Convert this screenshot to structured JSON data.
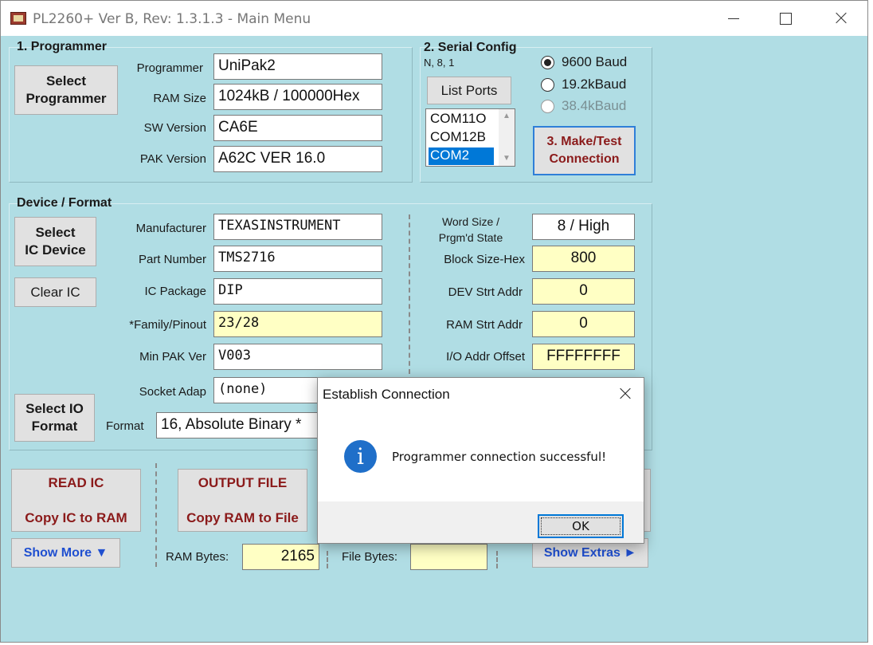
{
  "window": {
    "title": "PL2260+ Ver B, Rev: 1.3.1.3 - Main Menu"
  },
  "programmer": {
    "group_title": "1. Programmer",
    "select_button": "Select\nProgrammer",
    "fields": [
      {
        "label": "Programmer",
        "value": "UniPak2"
      },
      {
        "label": "RAM Size",
        "value": "1024kB / 100000Hex"
      },
      {
        "label": "SW Version",
        "value": "CA6E"
      },
      {
        "label": "PAK Version",
        "value": "A62C VER 16.0"
      }
    ]
  },
  "serial": {
    "group_title": "2. Serial Config",
    "subtitle": "N, 8, 1",
    "list_ports_button": "List Ports",
    "ports": [
      "COM11O",
      "COM12B",
      "COM2"
    ],
    "selected_port": "COM2",
    "baud_options": [
      {
        "label": "9600 Baud",
        "checked": true,
        "disabled": false
      },
      {
        "label": "19.2kBaud",
        "checked": false,
        "disabled": false
      },
      {
        "label": "38.4kBaud",
        "checked": false,
        "disabled": true
      }
    ],
    "connect_button": "3. Make/Test\nConnection"
  },
  "device": {
    "group_title": "Device / Format",
    "select_ic_button": "Select\nIC Device",
    "clear_ic_button": "Clear IC",
    "select_io_button": "Select IO\nFormat",
    "fields": [
      {
        "label": "Manufacturer",
        "value": "TEXASINSTRUMENT"
      },
      {
        "label": "Part Number",
        "value": "TMS2716"
      },
      {
        "label": "IC Package",
        "value": "DIP"
      },
      {
        "label": "*Family/Pinout",
        "value": "23/28"
      },
      {
        "label": "Min PAK Ver",
        "value": "V003"
      },
      {
        "label": "Socket Adap",
        "value": "(none)"
      }
    ],
    "format_label": "Format",
    "format_value": "16, Absolute Binary *",
    "right_fields": [
      {
        "label": "Word Size /\nPrgm'd State",
        "value": "8 / High"
      },
      {
        "label": "Block Size-Hex",
        "value": "800"
      },
      {
        "label": "DEV Strt Addr",
        "value": "0"
      },
      {
        "label": "RAM Strt Addr",
        "value": "0"
      },
      {
        "label": "I/O Addr Offset",
        "value": "FFFFFFFF"
      }
    ]
  },
  "actions": {
    "read_ic_title": "READ IC",
    "read_ic_sub": "Copy IC to RAM",
    "output_file_title": "OUTPUT FILE",
    "output_file_sub": "Copy RAM to File",
    "show_more": "Show More ▼",
    "show_extras": "Show Extras ►",
    "ram_bytes_label": "RAM Bytes:",
    "ram_bytes_value": "2165",
    "file_bytes_label": "File Bytes:",
    "file_bytes_value": ""
  },
  "dialog": {
    "title": "Establish Connection",
    "icon": "info-icon",
    "message": "Programmer connection successful!",
    "ok_label": "OK"
  }
}
